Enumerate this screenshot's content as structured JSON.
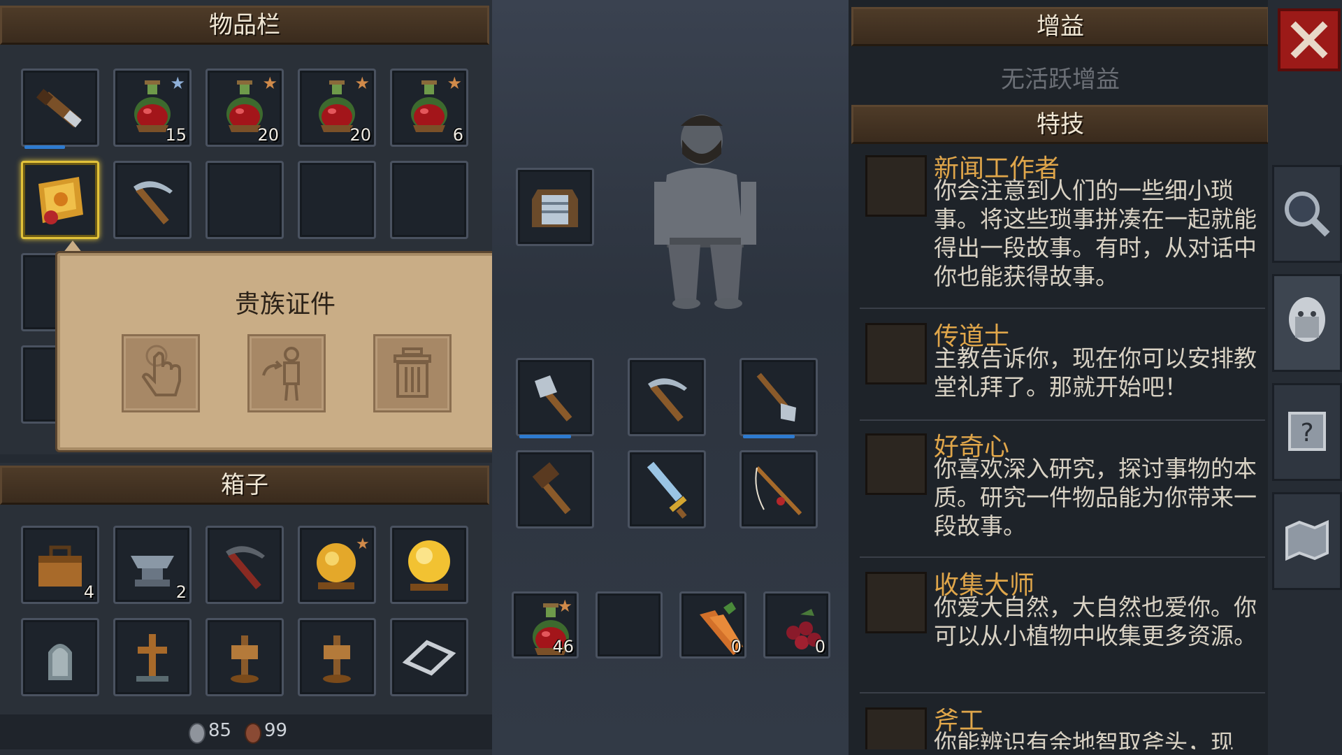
{
  "inventory": {
    "title": "物品栏",
    "slots": [
      {
        "icon": "spyglass-icon",
        "count": "",
        "star": "",
        "bar": 0.55
      },
      {
        "icon": "red-potion-icon",
        "count": "15",
        "star": "silver",
        "bar": 0
      },
      {
        "icon": "red-potion-icon",
        "count": "20",
        "star": "bronze",
        "bar": 0
      },
      {
        "icon": "red-potion-icon",
        "count": "20",
        "star": "bronze",
        "bar": 0
      },
      {
        "icon": "red-potion-icon",
        "count": "6",
        "star": "bronze",
        "bar": 0
      },
      {
        "icon": "noble-certificate-icon",
        "count": "",
        "star": "",
        "bar": 0,
        "selected": true
      },
      {
        "icon": "pickaxe-icon",
        "count": "",
        "star": "",
        "bar": 0
      },
      {
        "icon": "empty",
        "count": "",
        "star": "",
        "bar": 0
      },
      {
        "icon": "empty",
        "count": "",
        "star": "",
        "bar": 0
      },
      {
        "icon": "empty",
        "count": "",
        "star": "",
        "bar": 0
      }
    ]
  },
  "popup": {
    "title": "贵族证件",
    "buttons": [
      {
        "name": "use-button",
        "icon": "hand-pointer-icon"
      },
      {
        "name": "equip-button",
        "icon": "equip-figure-icon"
      },
      {
        "name": "trash-button",
        "icon": "trash-icon"
      }
    ]
  },
  "chest": {
    "title": "箱子",
    "slots": [
      {
        "icon": "toolbox-icon",
        "count": "4"
      },
      {
        "icon": "anvil-icon",
        "count": "2"
      },
      {
        "icon": "red-pickaxe-icon",
        "count": ""
      },
      {
        "icon": "gold-orb-star-icon",
        "count": ""
      },
      {
        "icon": "gold-orb-icon",
        "count": ""
      },
      {
        "icon": "gravestone-icon",
        "count": ""
      },
      {
        "icon": "cross-grave-icon",
        "count": ""
      },
      {
        "icon": "wooden-sign-icon",
        "count": ""
      },
      {
        "icon": "wooden-sign-icon",
        "count": ""
      },
      {
        "icon": "frame-icon",
        "count": ""
      }
    ],
    "currency_silver": "85",
    "currency_copper": "99"
  },
  "equipment": {
    "armor_slot": "chest-armor-icon",
    "tools": [
      "axe-icon",
      "pickaxe-icon",
      "shovel-icon",
      "hammer-icon",
      "sword-icon",
      "fishing-rod-icon"
    ],
    "quick_slots": [
      {
        "icon": "red-potion-icon",
        "count": "46"
      },
      {
        "icon": "empty",
        "count": ""
      },
      {
        "icon": "carrot-icon",
        "count": "0"
      },
      {
        "icon": "berries-icon",
        "count": "0"
      }
    ]
  },
  "buffs": {
    "title": "增益",
    "empty_text": "无活跃增益"
  },
  "perks": {
    "title": "特技",
    "items": [
      {
        "name": "新闻工作者",
        "desc": "你会注意到人们的一些细小琐事。将这些琐事拼凑在一起就能得出一段故事。有时，从对话中你也能获得故事。"
      },
      {
        "name": "传道士",
        "desc": "主教告诉你，现在你可以安排教堂礼拜了。那就开始吧！"
      },
      {
        "name": "好奇心",
        "desc": "你喜欢深入研究，探讨事物的本质。研究一件物品能为你带来一段故事。"
      },
      {
        "name": "收集大师",
        "desc": "你爱大自然，大自然也爱你。你可以从小植物中收集更多资源。"
      },
      {
        "name": "斧工",
        "desc": "你能辨识有余地智取斧头，现"
      }
    ]
  },
  "colors": {
    "accent_gold": "#e2c23a",
    "perk_name": "#e0a64a",
    "close_red": "#9c1a18",
    "header_brown": "#4e3b28"
  }
}
